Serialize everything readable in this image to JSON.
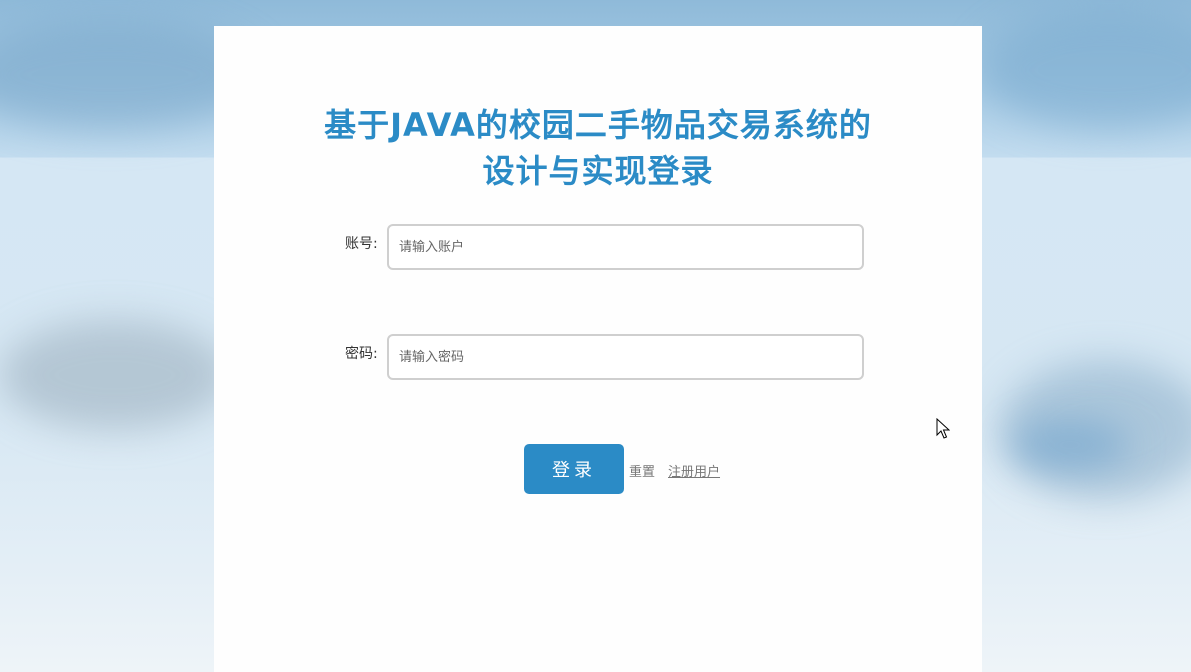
{
  "title": {
    "line1": "基于JAVA的校园二手物品交易系统的",
    "line2": "设计与实现登录"
  },
  "account": {
    "label": "账号:",
    "placeholder": "请输入账户",
    "value": ""
  },
  "password": {
    "label": "密码:",
    "placeholder": "请输入密码",
    "value": ""
  },
  "actions": {
    "login_label": "登录",
    "reset_label": "重置",
    "register_label": "注册用户"
  },
  "colors": {
    "accent": "#2b8bc6",
    "panel": "#fefefe",
    "link": "#777777"
  },
  "icons": {
    "cursor": "mouse-pointer-icon"
  }
}
